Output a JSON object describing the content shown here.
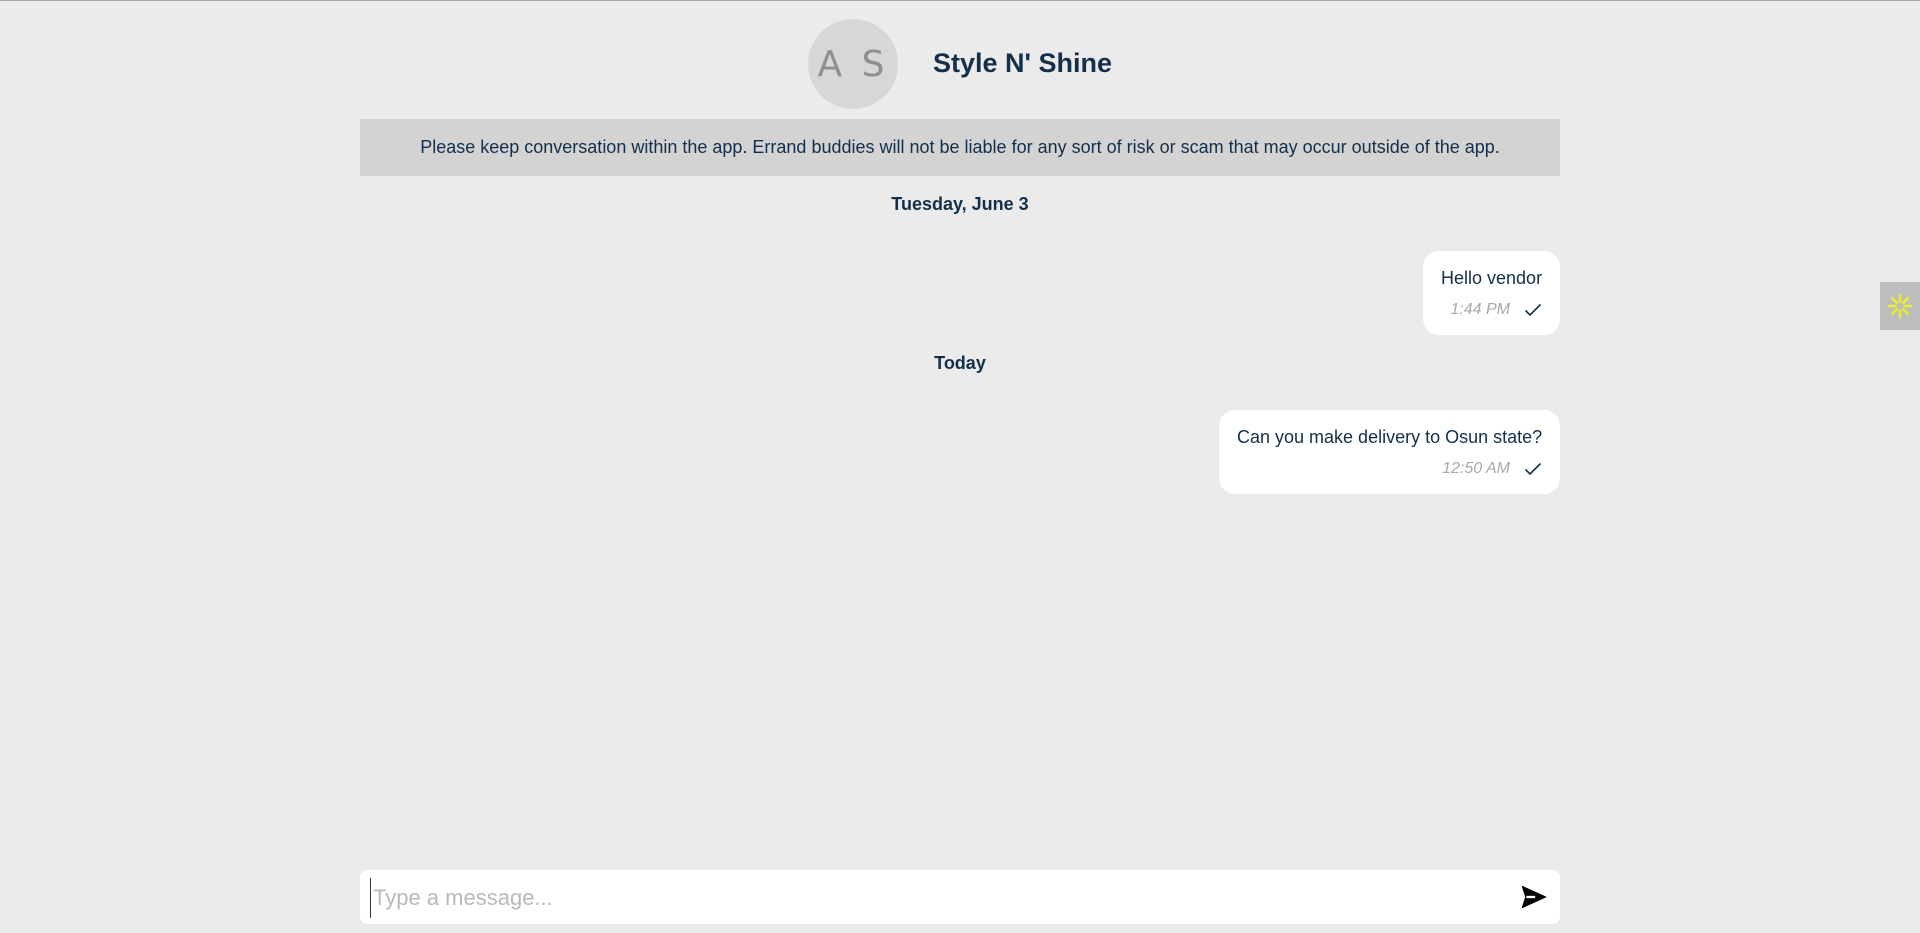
{
  "vendor": {
    "initials": "A S",
    "name": "Style N' Shine"
  },
  "notice": {
    "text": "Please keep conversation within the app. Errand buddies will not be liable for any sort of risk or scam that may occur outside of the app."
  },
  "messages": [
    {
      "date_label": "Tuesday, June 3",
      "text": "Hello vendor",
      "time": "1:44 PM",
      "status_icon": "check-icon"
    },
    {
      "date_label": "Today",
      "text": "Can you make delivery to Osun state?",
      "time": "12:50 AM",
      "status_icon": "check-icon"
    }
  ],
  "composer": {
    "placeholder": "Type a message...",
    "value": "",
    "send_icon": "send-icon"
  },
  "widget": {
    "icon": "asterisk-flower-icon",
    "color": "#e8f02a"
  },
  "colors": {
    "background": "#ebebeb",
    "notice_bg": "#d3d3d3",
    "text_primary": "#142f4a",
    "bubble_bg": "#ffffff",
    "time_text": "#a8a8a8"
  }
}
